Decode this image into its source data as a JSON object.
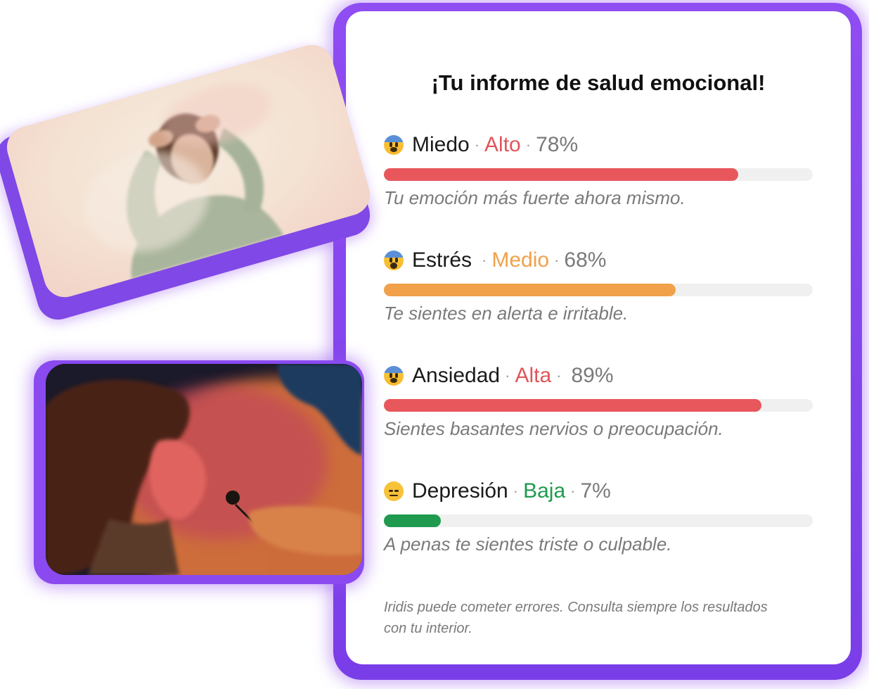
{
  "title": "¡Tu informe de salud emocional!",
  "metrics": [
    {
      "emoji": "fearful-face-icon",
      "name": "Miedo",
      "level": "Alto",
      "percent_label": "78%",
      "percent": 78,
      "color": "#e8575c",
      "description": "Tu emoción más fuerte ahora mismo."
    },
    {
      "emoji": "screaming-face-icon",
      "name": "Estrés",
      "level": "Medio",
      "percent_label": "68%",
      "percent": 68,
      "color": "#f0a14a",
      "description": "Te sientes en alerta e irritable."
    },
    {
      "emoji": "anxious-sweat-face-icon",
      "name": "Ansiedad",
      "level": "Alta",
      "percent_label": "89%",
      "percent": 89,
      "color": "#e8575c",
      "description": "Sientes basantes nervios o preocupación."
    },
    {
      "emoji": "pensive-face-icon",
      "name": "Depresión",
      "level": "Baja",
      "percent_label": "7%",
      "percent": 7,
      "color": "#1f9a4f",
      "description": "A penas te sientes triste o culpable."
    }
  ],
  "separator": "·",
  "disclaimer": "Iridis puede cometer errores. Consulta siempre los resultados con tu interior."
}
